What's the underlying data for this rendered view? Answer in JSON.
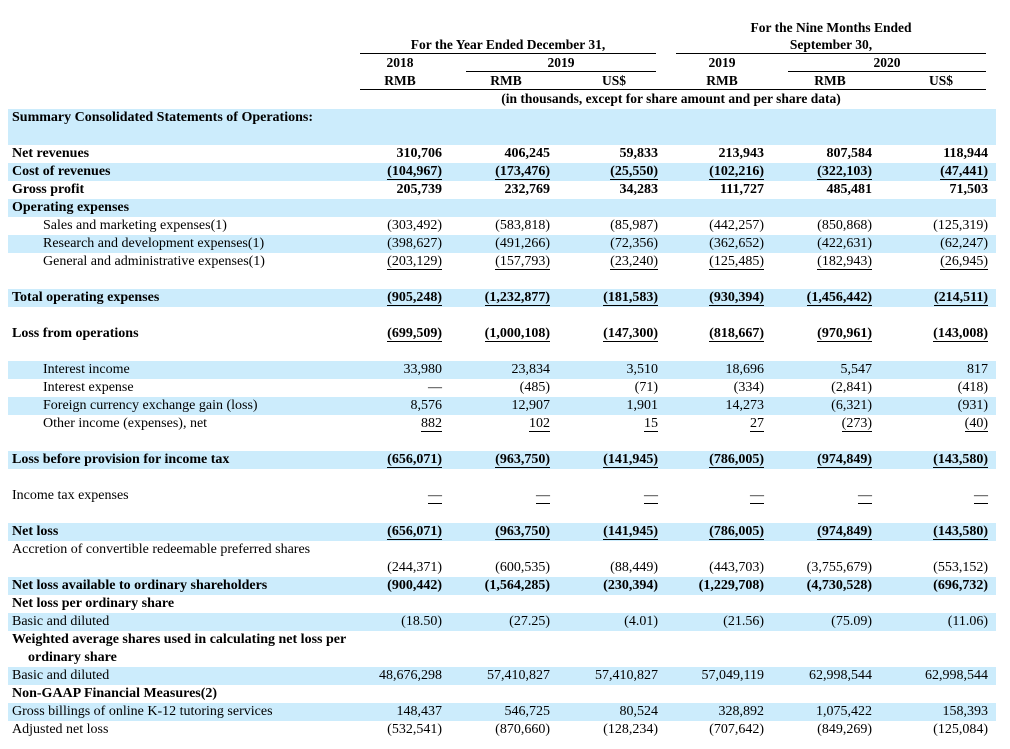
{
  "header": {
    "group_year": "For the Year Ended December 31,",
    "group_nine_line1": "For the Nine Months Ended",
    "group_nine_line2": "September 30,",
    "year_2018": "2018",
    "year_2019": "2019",
    "nine_2019": "2019",
    "nine_2020": "2020",
    "currencies": [
      "RMB",
      "RMB",
      "US$",
      "RMB",
      "RMB",
      "US$"
    ],
    "units_note": "(in thousands, except for share amount and per share data)"
  },
  "rows": [
    {
      "label": "Summary Consolidated Statements of Operations:",
      "style": "bold",
      "values": []
    },
    {
      "label": "Net revenues",
      "style": "bold",
      "values": [
        "310,706",
        "406,245",
        "59,833",
        "213,943",
        "807,584",
        "118,944"
      ]
    },
    {
      "label": "Cost of revenues",
      "style": "bold",
      "values": [
        "(104,967)",
        "(173,476)",
        "(25,550)",
        "(102,216)",
        "(322,103)",
        "(47,441)"
      ]
    },
    {
      "label": "Gross profit",
      "style": "bold",
      "values": [
        "205,739",
        "232,769",
        "34,283",
        "111,727",
        "485,481",
        "71,503"
      ]
    },
    {
      "label": "Operating expenses",
      "style": "bold",
      "values": []
    },
    {
      "label": "Sales and marketing expenses(1)",
      "style": "indent",
      "values": [
        "(303,492)",
        "(583,818)",
        "(85,987)",
        "(442,257)",
        "(850,868)",
        "(125,319)"
      ]
    },
    {
      "label": "Research and development expenses(1)",
      "style": "indent",
      "values": [
        "(398,627)",
        "(491,266)",
        "(72,356)",
        "(362,652)",
        "(422,631)",
        "(62,247)"
      ]
    },
    {
      "label": "General and administrative expenses(1)",
      "style": "indent",
      "values": [
        "(203,129)",
        "(157,793)",
        "(23,240)",
        "(125,485)",
        "(182,943)",
        "(26,945)"
      ]
    },
    {
      "label": "Total operating expenses",
      "style": "bold",
      "values": [
        "(905,248)",
        "(1,232,877)",
        "(181,583)",
        "(930,394)",
        "(1,456,442)",
        "(214,511)"
      ]
    },
    {
      "label": "Loss from operations",
      "style": "bold",
      "values": [
        "(699,509)",
        "(1,000,108)",
        "(147,300)",
        "(818,667)",
        "(970,961)",
        "(143,008)"
      ]
    },
    {
      "label": "Interest income",
      "style": "indent",
      "values": [
        "33,980",
        "23,834",
        "3,510",
        "18,696",
        "5,547",
        "817"
      ]
    },
    {
      "label": "Interest expense",
      "style": "indent",
      "values": [
        "—",
        "(485)",
        "(71)",
        "(334)",
        "(2,841)",
        "(418)"
      ]
    },
    {
      "label": "Foreign currency exchange gain (loss)",
      "style": "indent",
      "values": [
        "8,576",
        "12,907",
        "1,901",
        "14,273",
        "(6,321)",
        "(931)"
      ]
    },
    {
      "label": "Other income (expenses), net",
      "style": "indent",
      "values": [
        "882",
        "102",
        "15",
        "27",
        "(273)",
        "(40)"
      ]
    },
    {
      "label": "Loss before provision for income tax",
      "style": "bold",
      "values": [
        "(656,071)",
        "(963,750)",
        "(141,945)",
        "(786,005)",
        "(974,849)",
        "(143,580)"
      ]
    },
    {
      "label": "Income tax expenses",
      "style": "plain",
      "values": [
        "—",
        "—",
        "—",
        "—",
        "—",
        "—"
      ]
    },
    {
      "label": "Net loss",
      "style": "bold",
      "values": [
        "(656,071)",
        "(963,750)",
        "(141,945)",
        "(786,005)",
        "(974,849)",
        "(143,580)"
      ]
    },
    {
      "label": "Accretion of convertible redeemable preferred shares",
      "style": "plain",
      "values": [
        "(244,371)",
        "(600,535)",
        "(88,449)",
        "(443,703)",
        "(3,755,679)",
        "(553,152)"
      ]
    },
    {
      "label": "Net loss available to ordinary shareholders",
      "style": "bold",
      "values": [
        "(900,442)",
        "(1,564,285)",
        "(230,394)",
        "(1,229,708)",
        "(4,730,528)",
        "(696,732)"
      ]
    },
    {
      "label": "Net loss per ordinary share",
      "style": "bold",
      "values": []
    },
    {
      "label": "Basic and diluted",
      "style": "plain",
      "values": [
        "(18.50)",
        "(27.25)",
        "(4.01)",
        "(21.56)",
        "(75.09)",
        "(11.06)"
      ]
    },
    {
      "label": "Weighted average shares used in calculating net loss per ordinary share",
      "style": "bold",
      "values": []
    },
    {
      "label": "Basic and diluted",
      "style": "plain",
      "values": [
        "48,676,298",
        "57,410,827",
        "57,410,827",
        "57,049,119",
        "62,998,544",
        "62,998,544"
      ]
    },
    {
      "label": "Non-GAAP Financial Measures(2)",
      "style": "bold",
      "values": []
    },
    {
      "label": "Gross billings of online K-12 tutoring services",
      "style": "plain",
      "values": [
        "148,437",
        "546,725",
        "80,524",
        "328,892",
        "1,075,422",
        "158,393"
      ]
    },
    {
      "label": "Adjusted net loss",
      "style": "plain",
      "values": [
        "(532,541)",
        "(870,660)",
        "(128,234)",
        "(707,642)",
        "(849,269)",
        "(125,084)"
      ]
    }
  ]
}
